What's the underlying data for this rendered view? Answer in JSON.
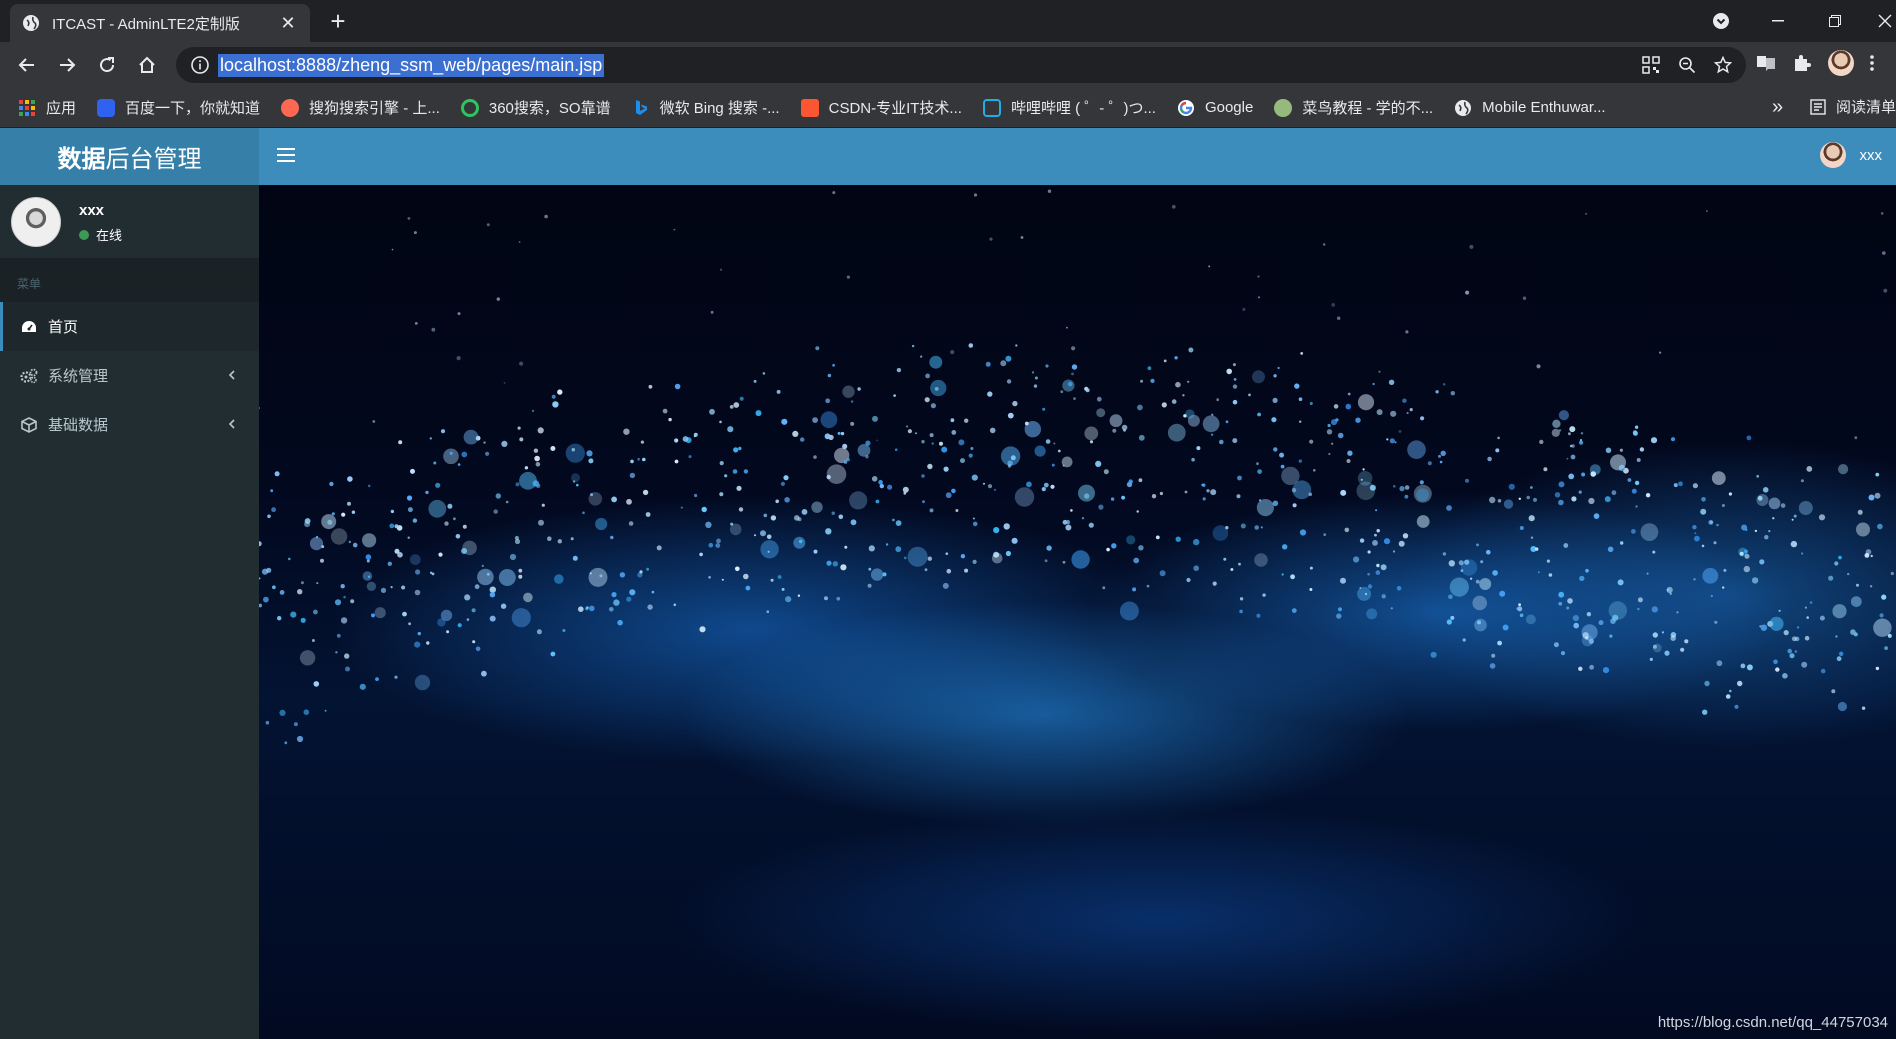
{
  "browser": {
    "tab_title": "ITCAST - AdminLTE2定制版",
    "url": "localhost:8888/zheng_ssm_web/pages/main.jsp",
    "bookmarks": [
      {
        "label": "应用",
        "icon": "apps-grid-icon",
        "color": "#ea4335"
      },
      {
        "label": "百度一下，你就知道",
        "icon": "baidu-paw-icon",
        "color": "#3062f0"
      },
      {
        "label": "搜狗搜索引擎 - 上...",
        "icon": "sogou-icon",
        "color": "#fd6853"
      },
      {
        "label": "360搜索，SO靠谱",
        "icon": "360-icon",
        "color": "#2ec55b"
      },
      {
        "label": "微软 Bing 搜索 -...",
        "icon": "bing-icon",
        "color": "#1b8ef0"
      },
      {
        "label": "CSDN-专业IT技术...",
        "icon": "csdn-icon",
        "color": "#fc5531"
      },
      {
        "label": "哔哩哔哩 ( ゜- ゜)つ...",
        "icon": "bilibili-icon",
        "color": "#23ade5"
      },
      {
        "label": "Google",
        "icon": "google-icon",
        "color": "#ffffff"
      },
      {
        "label": "菜鸟教程 - 学的不...",
        "icon": "runoob-icon",
        "color": "#96b97d"
      },
      {
        "label": "Mobile Enthuwar...",
        "icon": "globe-icon",
        "color": "#e8eaed"
      }
    ],
    "more_label": "»",
    "reading_list": "阅读清单"
  },
  "app": {
    "logo_bold": "数据",
    "logo_rest": "后台管理",
    "nav_user_name": "xxx",
    "sidebar": {
      "user_name": "xxx",
      "user_status": "在线",
      "menu_header": "菜单",
      "items": [
        {
          "label": "首页",
          "icon": "dashboard-icon",
          "active": true
        },
        {
          "label": "系统管理",
          "icon": "cogs-icon",
          "active": false
        },
        {
          "label": "基础数据",
          "icon": "cube-icon",
          "active": false
        }
      ]
    },
    "watermark": "https://blog.csdn.net/qq_44757034"
  },
  "colors": {
    "navbar": "#3c8dbc",
    "logo_bg": "#367fa9",
    "sidebar_bg": "#222d32",
    "status_online": "#3c9a55"
  }
}
